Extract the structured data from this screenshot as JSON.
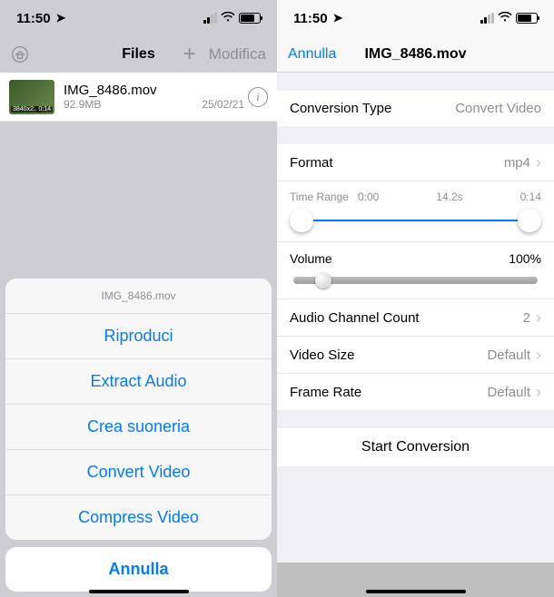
{
  "status": {
    "time": "11:50"
  },
  "left": {
    "nav": {
      "title": "Files",
      "plus": "+",
      "edit": "Modifica"
    },
    "file": {
      "name": "IMG_8486.mov",
      "size": "92.9MB",
      "date": "25/02/21",
      "res": "3840x2...",
      "dur": "0:14"
    },
    "sheet": {
      "header": "IMG_8486.mov",
      "opts": [
        "Riproduci",
        "Extract Audio",
        "Crea suoneria",
        "Convert Video",
        "Compress Video"
      ],
      "cancel": "Annulla"
    }
  },
  "right": {
    "nav": {
      "back": "Annulla",
      "title": "IMG_8486.mov"
    },
    "conv": {
      "type_label": "Conversion Type",
      "type_value": "Convert Video",
      "format_label": "Format",
      "format_value": "mp4",
      "time_label": "Time Range",
      "time_start": "0:00",
      "time_mid": "14.2s",
      "time_end": "0:14",
      "volume_label": "Volume",
      "volume_value": "100%",
      "audio_label": "Audio Channel Count",
      "audio_value": "2",
      "size_label": "Video Size",
      "size_value": "Default",
      "fps_label": "Frame Rate",
      "fps_value": "Default"
    },
    "start": "Start Conversion"
  }
}
